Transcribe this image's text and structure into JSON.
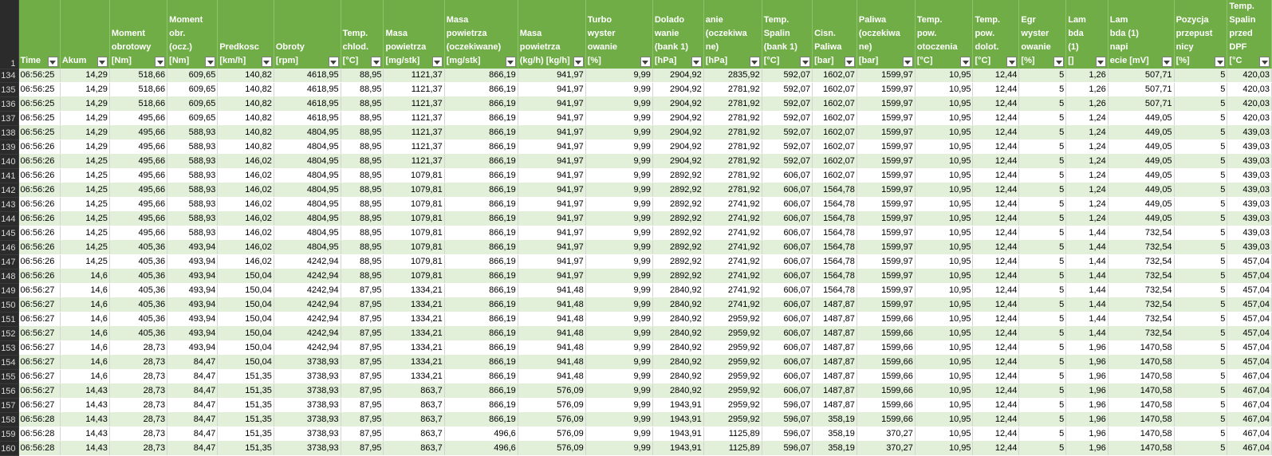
{
  "row_numbers": {
    "header": "1",
    "rows": [
      "134",
      "135",
      "136",
      "137",
      "138",
      "139",
      "140",
      "141",
      "142",
      "143",
      "144",
      "145",
      "146",
      "147",
      "148",
      "149",
      "150",
      "151",
      "152",
      "153",
      "154",
      "155",
      "156",
      "157",
      "158",
      "159",
      "160"
    ]
  },
  "columns": [
    "Time",
    "Akum",
    "Moment\nobrotowy\n[Nm]",
    "Moment\nobr.\n(ocz.)\n[Nm]",
    "Predkosc\n[km/h]",
    "Obroty\n[rpm]",
    "Temp.\nchlod.\n[°C]",
    "Masa\npowietrza\n[mg/stk]",
    "Masa\npowietrza\n(oczekiwane)\n[mg/stk]",
    "Masa\npowietrza\n(kg/h) [kg/h]",
    "Turbo\nwyster\nowanie\n[%]",
    "Dolado\nwanie\n(bank 1)\n[hPa]",
    "anie\n(oczekiwa\nne)\n[hPa]",
    "Temp.\nSpalin\n(bank 1)\n[°C]",
    "Cisn.\nPaliwa\n[bar]",
    "Paliwa\n(oczekiwa\nne)\n[bar]",
    "Temp.\npow.\notoczenia\n[°C]",
    "Temp.\npow.\ndolot.\n[°C]",
    "Egr\nwyster\nowanie\n[%]",
    "Lam\nbda (1)\n[]",
    "Lam\nbda (1)\nnapi\necie [mV]",
    "Pozycja\nprzepust\nnicy\n[%]",
    "Temp.\nSpalin\nprzed\nDPF [°C"
  ],
  "rows": [
    [
      "06:56:25",
      "14,29",
      "518,66",
      "609,65",
      "140,82",
      "4618,95",
      "88,95",
      "1121,37",
      "866,19",
      "941,97",
      "9,99",
      "2904,92",
      "2835,92",
      "592,07",
      "1602,07",
      "1599,97",
      "10,95",
      "12,44",
      "5",
      "1,26",
      "507,71",
      "5",
      "420,03"
    ],
    [
      "06:56:25",
      "14,29",
      "518,66",
      "609,65",
      "140,82",
      "4618,95",
      "88,95",
      "1121,37",
      "866,19",
      "941,97",
      "9,99",
      "2904,92",
      "2781,92",
      "592,07",
      "1602,07",
      "1599,97",
      "10,95",
      "12,44",
      "5",
      "1,26",
      "507,71",
      "5",
      "420,03"
    ],
    [
      "06:56:25",
      "14,29",
      "518,66",
      "609,65",
      "140,82",
      "4618,95",
      "88,95",
      "1121,37",
      "866,19",
      "941,97",
      "9,99",
      "2904,92",
      "2781,92",
      "592,07",
      "1602,07",
      "1599,97",
      "10,95",
      "12,44",
      "5",
      "1,26",
      "507,71",
      "5",
      "420,03"
    ],
    [
      "06:56:25",
      "14,29",
      "495,66",
      "609,65",
      "140,82",
      "4618,95",
      "88,95",
      "1121,37",
      "866,19",
      "941,97",
      "9,99",
      "2904,92",
      "2781,92",
      "592,07",
      "1602,07",
      "1599,97",
      "10,95",
      "12,44",
      "5",
      "1,24",
      "449,05",
      "5",
      "420,03"
    ],
    [
      "06:56:25",
      "14,29",
      "495,66",
      "588,93",
      "140,82",
      "4804,95",
      "88,95",
      "1121,37",
      "866,19",
      "941,97",
      "9,99",
      "2904,92",
      "2781,92",
      "592,07",
      "1602,07",
      "1599,97",
      "10,95",
      "12,44",
      "5",
      "1,24",
      "449,05",
      "5",
      "439,03"
    ],
    [
      "06:56:26",
      "14,29",
      "495,66",
      "588,93",
      "140,82",
      "4804,95",
      "88,95",
      "1121,37",
      "866,19",
      "941,97",
      "9,99",
      "2904,92",
      "2781,92",
      "592,07",
      "1602,07",
      "1599,97",
      "10,95",
      "12,44",
      "5",
      "1,24",
      "449,05",
      "5",
      "439,03"
    ],
    [
      "06:56:26",
      "14,25",
      "495,66",
      "588,93",
      "146,02",
      "4804,95",
      "88,95",
      "1121,37",
      "866,19",
      "941,97",
      "9,99",
      "2904,92",
      "2781,92",
      "592,07",
      "1602,07",
      "1599,97",
      "10,95",
      "12,44",
      "5",
      "1,24",
      "449,05",
      "5",
      "439,03"
    ],
    [
      "06:56:26",
      "14,25",
      "495,66",
      "588,93",
      "146,02",
      "4804,95",
      "88,95",
      "1079,81",
      "866,19",
      "941,97",
      "9,99",
      "2892,92",
      "2781,92",
      "606,07",
      "1602,07",
      "1599,97",
      "10,95",
      "12,44",
      "5",
      "1,24",
      "449,05",
      "5",
      "439,03"
    ],
    [
      "06:56:26",
      "14,25",
      "495,66",
      "588,93",
      "146,02",
      "4804,95",
      "88,95",
      "1079,81",
      "866,19",
      "941,97",
      "9,99",
      "2892,92",
      "2781,92",
      "606,07",
      "1564,78",
      "1599,97",
      "10,95",
      "12,44",
      "5",
      "1,24",
      "449,05",
      "5",
      "439,03"
    ],
    [
      "06:56:26",
      "14,25",
      "495,66",
      "588,93",
      "146,02",
      "4804,95",
      "88,95",
      "1079,81",
      "866,19",
      "941,97",
      "9,99",
      "2892,92",
      "2741,92",
      "606,07",
      "1564,78",
      "1599,97",
      "10,95",
      "12,44",
      "5",
      "1,24",
      "449,05",
      "5",
      "439,03"
    ],
    [
      "06:56:26",
      "14,25",
      "495,66",
      "588,93",
      "146,02",
      "4804,95",
      "88,95",
      "1079,81",
      "866,19",
      "941,97",
      "9,99",
      "2892,92",
      "2741,92",
      "606,07",
      "1564,78",
      "1599,97",
      "10,95",
      "12,44",
      "5",
      "1,24",
      "449,05",
      "5",
      "439,03"
    ],
    [
      "06:56:26",
      "14,25",
      "495,66",
      "588,93",
      "146,02",
      "4804,95",
      "88,95",
      "1079,81",
      "866,19",
      "941,97",
      "9,99",
      "2892,92",
      "2741,92",
      "606,07",
      "1564,78",
      "1599,97",
      "10,95",
      "12,44",
      "5",
      "1,44",
      "732,54",
      "5",
      "439,03"
    ],
    [
      "06:56:26",
      "14,25",
      "405,36",
      "493,94",
      "146,02",
      "4804,95",
      "88,95",
      "1079,81",
      "866,19",
      "941,97",
      "9,99",
      "2892,92",
      "2741,92",
      "606,07",
      "1564,78",
      "1599,97",
      "10,95",
      "12,44",
      "5",
      "1,44",
      "732,54",
      "5",
      "439,03"
    ],
    [
      "06:56:26",
      "14,25",
      "405,36",
      "493,94",
      "146,02",
      "4242,94",
      "88,95",
      "1079,81",
      "866,19",
      "941,97",
      "9,99",
      "2892,92",
      "2741,92",
      "606,07",
      "1564,78",
      "1599,97",
      "10,95",
      "12,44",
      "5",
      "1,44",
      "732,54",
      "5",
      "457,04"
    ],
    [
      "06:56:26",
      "14,6",
      "405,36",
      "493,94",
      "150,04",
      "4242,94",
      "88,95",
      "1079,81",
      "866,19",
      "941,97",
      "9,99",
      "2892,92",
      "2741,92",
      "606,07",
      "1564,78",
      "1599,97",
      "10,95",
      "12,44",
      "5",
      "1,44",
      "732,54",
      "5",
      "457,04"
    ],
    [
      "06:56:27",
      "14,6",
      "405,36",
      "493,94",
      "150,04",
      "4242,94",
      "87,95",
      "1334,21",
      "866,19",
      "941,48",
      "9,99",
      "2840,92",
      "2741,92",
      "606,07",
      "1564,78",
      "1599,97",
      "10,95",
      "12,44",
      "5",
      "1,44",
      "732,54",
      "5",
      "457,04"
    ],
    [
      "06:56:27",
      "14,6",
      "405,36",
      "493,94",
      "150,04",
      "4242,94",
      "87,95",
      "1334,21",
      "866,19",
      "941,48",
      "9,99",
      "2840,92",
      "2741,92",
      "606,07",
      "1487,87",
      "1599,97",
      "10,95",
      "12,44",
      "5",
      "1,44",
      "732,54",
      "5",
      "457,04"
    ],
    [
      "06:56:27",
      "14,6",
      "405,36",
      "493,94",
      "150,04",
      "4242,94",
      "87,95",
      "1334,21",
      "866,19",
      "941,48",
      "9,99",
      "2840,92",
      "2959,92",
      "606,07",
      "1487,87",
      "1599,66",
      "10,95",
      "12,44",
      "5",
      "1,44",
      "732,54",
      "5",
      "457,04"
    ],
    [
      "06:56:27",
      "14,6",
      "405,36",
      "493,94",
      "150,04",
      "4242,94",
      "87,95",
      "1334,21",
      "866,19",
      "941,48",
      "9,99",
      "2840,92",
      "2959,92",
      "606,07",
      "1487,87",
      "1599,66",
      "10,95",
      "12,44",
      "5",
      "1,44",
      "732,54",
      "5",
      "457,04"
    ],
    [
      "06:56:27",
      "14,6",
      "28,73",
      "493,94",
      "150,04",
      "4242,94",
      "87,95",
      "1334,21",
      "866,19",
      "941,48",
      "9,99",
      "2840,92",
      "2959,92",
      "606,07",
      "1487,87",
      "1599,66",
      "10,95",
      "12,44",
      "5",
      "1,96",
      "1470,58",
      "5",
      "457,04"
    ],
    [
      "06:56:27",
      "14,6",
      "28,73",
      "84,47",
      "150,04",
      "3738,93",
      "87,95",
      "1334,21",
      "866,19",
      "941,48",
      "9,99",
      "2840,92",
      "2959,92",
      "606,07",
      "1487,87",
      "1599,66",
      "10,95",
      "12,44",
      "5",
      "1,96",
      "1470,58",
      "5",
      "457,04"
    ],
    [
      "06:56:27",
      "14,6",
      "28,73",
      "84,47",
      "151,35",
      "3738,93",
      "87,95",
      "1334,21",
      "866,19",
      "941,48",
      "9,99",
      "2840,92",
      "2959,92",
      "606,07",
      "1487,87",
      "1599,66",
      "10,95",
      "12,44",
      "5",
      "1,96",
      "1470,58",
      "5",
      "467,04"
    ],
    [
      "06:56:27",
      "14,43",
      "28,73",
      "84,47",
      "151,35",
      "3738,93",
      "87,95",
      "863,7",
      "866,19",
      "576,09",
      "9,99",
      "2840,92",
      "2959,92",
      "606,07",
      "1487,87",
      "1599,66",
      "10,95",
      "12,44",
      "5",
      "1,96",
      "1470,58",
      "5",
      "467,04"
    ],
    [
      "06:56:27",
      "14,43",
      "28,73",
      "84,47",
      "151,35",
      "3738,93",
      "87,95",
      "863,7",
      "866,19",
      "576,09",
      "9,99",
      "1943,91",
      "2959,92",
      "596,07",
      "1487,87",
      "1599,66",
      "10,95",
      "12,44",
      "5",
      "1,96",
      "1470,58",
      "5",
      "467,04"
    ],
    [
      "06:56:28",
      "14,43",
      "28,73",
      "84,47",
      "151,35",
      "3738,93",
      "87,95",
      "863,7",
      "866,19",
      "576,09",
      "9,99",
      "1943,91",
      "2959,92",
      "596,07",
      "358,19",
      "1599,66",
      "10,95",
      "12,44",
      "5",
      "1,96",
      "1470,58",
      "5",
      "467,04"
    ],
    [
      "06:56:28",
      "14,43",
      "28,73",
      "84,47",
      "151,35",
      "3738,93",
      "87,95",
      "863,7",
      "496,6",
      "576,09",
      "9,99",
      "1943,91",
      "1125,89",
      "596,07",
      "358,19",
      "370,27",
      "10,95",
      "12,44",
      "5",
      "1,96",
      "1470,58",
      "5",
      "467,04"
    ],
    [
      "06:56:28",
      "14,43",
      "28,73",
      "84,47",
      "151,35",
      "3738,93",
      "87,95",
      "863,7",
      "496,6",
      "576,09",
      "9,99",
      "1943,91",
      "1125,89",
      "596,07",
      "358,19",
      "370,27",
      "10,95",
      "12,44",
      "5",
      "1,96",
      "1470,58",
      "5",
      "467,04"
    ]
  ],
  "colors": {
    "header_bg": "#70ad47",
    "band": "#e2efd9",
    "rownum_bg": "#2b2b2b"
  }
}
